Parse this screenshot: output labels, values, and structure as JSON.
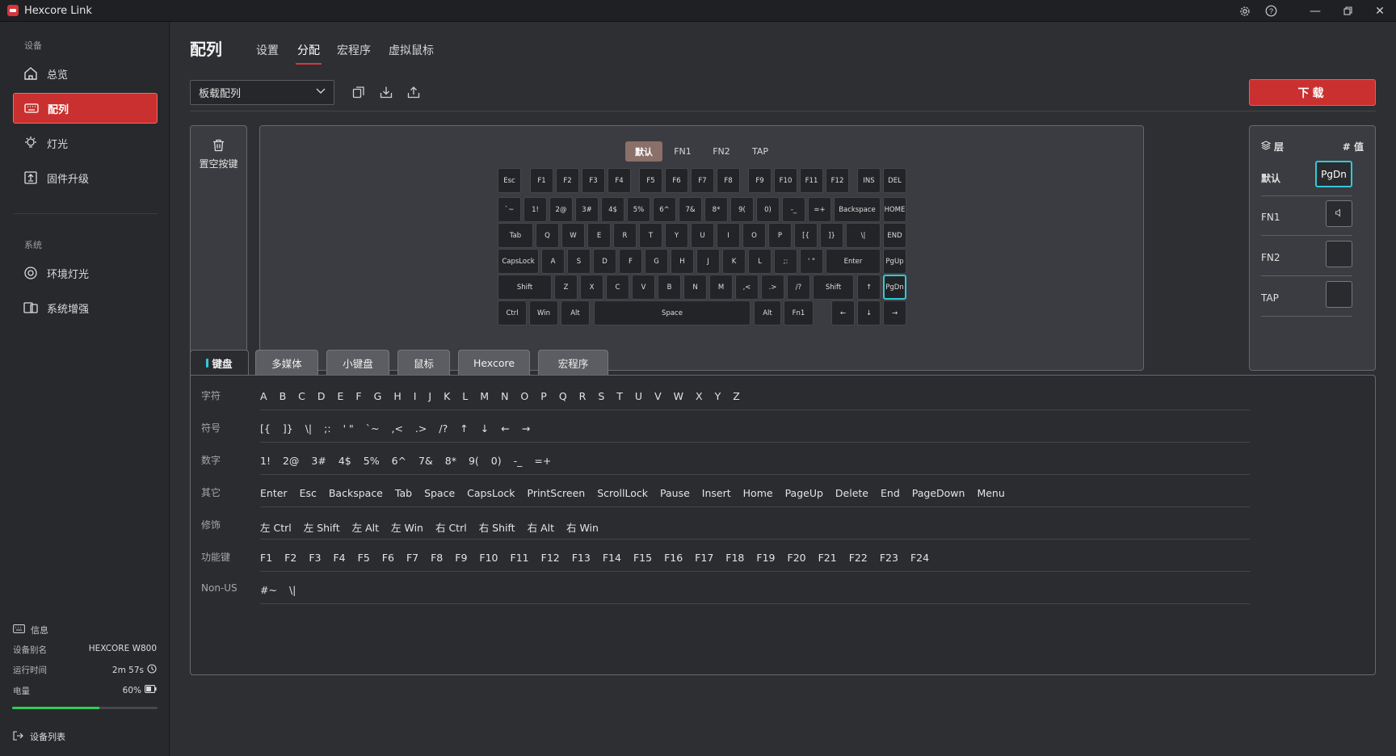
{
  "titlebar": {
    "app_title": "Hexcore Link"
  },
  "sidebar": {
    "section_device": "设备",
    "section_system": "系统",
    "items": [
      {
        "label": "总览"
      },
      {
        "label": "配列"
      },
      {
        "label": "灯光"
      },
      {
        "label": "固件升级"
      }
    ],
    "system_items": [
      {
        "label": "环境灯光"
      },
      {
        "label": "系统增强"
      }
    ],
    "info": {
      "header": "信息",
      "alias_label": "设备别名",
      "alias_value": "HEXCORE W800",
      "uptime_label": "运行时间",
      "uptime_value": "2m 57s",
      "battery_label": "电量",
      "battery_value": "60%",
      "battery_level": 0.6,
      "device_list": "设备列表"
    }
  },
  "header": {
    "page_title": "配列",
    "tabs": [
      {
        "label": "设置"
      },
      {
        "label": "分配"
      },
      {
        "label": "宏程序"
      },
      {
        "label": "虚拟鼠标"
      }
    ],
    "active_tab": "分配"
  },
  "toolbar": {
    "preset_value": "板载配列",
    "download_label": "下载"
  },
  "clear_key": {
    "label": "置空按键"
  },
  "keyboard": {
    "layer_tabs": [
      "默认",
      "FN1",
      "FN2",
      "TAP"
    ],
    "active_layer": "默认",
    "selected_key": "PgDn",
    "row0": [
      "Esc",
      "F1",
      "F2",
      "F3",
      "F4",
      "F5",
      "F6",
      "F7",
      "F8",
      "F9",
      "F10",
      "F11",
      "F12",
      "INS",
      "DEL"
    ],
    "row1": [
      "`~",
      "1!",
      "2@",
      "3#",
      "4$",
      "5%",
      "6^",
      "7&",
      "8*",
      "9(",
      "0)",
      "-_",
      "=+",
      "Backspace",
      "HOME"
    ],
    "row2": [
      "Tab",
      "Q",
      "W",
      "E",
      "R",
      "T",
      "Y",
      "U",
      "I",
      "O",
      "P",
      "[{",
      "]}",
      "\\|",
      "END"
    ],
    "row3": [
      "CapsLock",
      "A",
      "S",
      "D",
      "F",
      "G",
      "H",
      "J",
      "K",
      "L",
      ";:",
      "' \"",
      "Enter",
      "PgUp"
    ],
    "row4": [
      "Shift",
      "Z",
      "X",
      "C",
      "V",
      "B",
      "N",
      "M",
      ",<",
      ".>",
      "/?",
      "Shift",
      "↑",
      "PgDn"
    ],
    "row5": [
      "Ctrl",
      "Win",
      "Alt",
      "Space",
      "Alt",
      "Fn1",
      "←",
      "↓",
      "→"
    ]
  },
  "layers_panel": {
    "layer_header": "层",
    "value_header": "# 值",
    "rows": [
      {
        "label": "默认",
        "value": "PgDn"
      },
      {
        "label": "FN1",
        "value": ""
      },
      {
        "label": "FN2",
        "value": ""
      },
      {
        "label": "TAP",
        "value": ""
      }
    ]
  },
  "bottom_tabs": [
    {
      "label": "键盘"
    },
    {
      "label": "多媒体"
    },
    {
      "label": "小键盘"
    },
    {
      "label": "鼠标"
    },
    {
      "label": "Hexcore"
    },
    {
      "label": "宏程序"
    }
  ],
  "key_groups": [
    {
      "label": "字符",
      "items": [
        "A",
        "B",
        "C",
        "D",
        "E",
        "F",
        "G",
        "H",
        "I",
        "J",
        "K",
        "L",
        "M",
        "N",
        "O",
        "P",
        "Q",
        "R",
        "S",
        "T",
        "U",
        "V",
        "W",
        "X",
        "Y",
        "Z"
      ]
    },
    {
      "label": "符号",
      "items": [
        "[{",
        "]}",
        "\\|",
        ";:",
        "' \"",
        "`~",
        ",<",
        ".>",
        "/?",
        "↑",
        "↓",
        "←",
        "→"
      ]
    },
    {
      "label": "数字",
      "items": [
        "1!",
        "2@",
        "3#",
        "4$",
        "5%",
        "6^",
        "7&",
        "8*",
        "9(",
        "0)",
        "-_",
        "=+"
      ]
    },
    {
      "label": "其它",
      "items": [
        "Enter",
        "Esc",
        "Backspace",
        "Tab",
        "Space",
        "CapsLock",
        "PrintScreen",
        "ScrollLock",
        "Pause",
        "Insert",
        "Home",
        "PageUp",
        "Delete",
        "End",
        "PageDown",
        "Menu"
      ]
    },
    {
      "label": "修饰",
      "items": [
        "左 Ctrl",
        "左 Shift",
        "左 Alt",
        "左 Win",
        "右 Ctrl",
        "右 Shift",
        "右 Alt",
        "右 Win"
      ]
    },
    {
      "label": "功能键",
      "items": [
        "F1",
        "F2",
        "F3",
        "F4",
        "F5",
        "F6",
        "F7",
        "F8",
        "F9",
        "F10",
        "F11",
        "F12",
        "F13",
        "F14",
        "F15",
        "F16",
        "F17",
        "F18",
        "F19",
        "F20",
        "F21",
        "F22",
        "F23",
        "F24"
      ]
    },
    {
      "label": "Non-US",
      "items": [
        "#~",
        "\\|"
      ]
    }
  ],
  "colors": {
    "accent": "#c9302f",
    "selection": "#33c8d8",
    "battery": "#2ecc5a"
  }
}
